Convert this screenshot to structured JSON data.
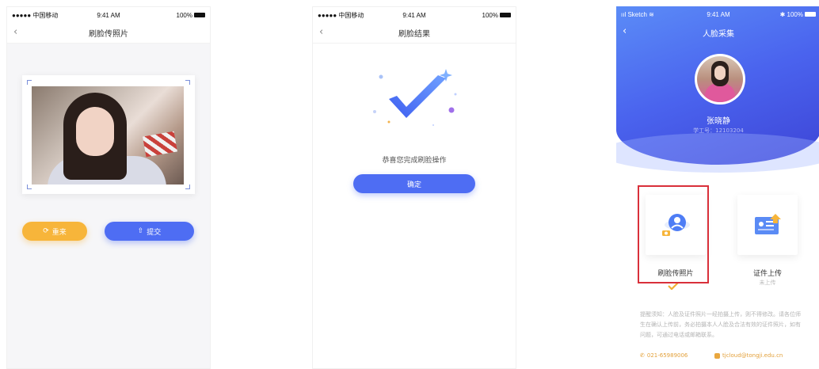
{
  "phone1": {
    "status": {
      "carrier": "●●●●● 中国移动",
      "time": "9:41 AM",
      "battery": "100%"
    },
    "title": "刷脸传照片",
    "retake_label": "重来",
    "submit_label": "提交"
  },
  "phone2": {
    "status": {
      "carrier": "●●●●● 中国移动",
      "time": "9:41 AM",
      "battery": "100%"
    },
    "title": "刷脸结果",
    "message": "恭喜您完成刷脸操作",
    "confirm_label": "确定"
  },
  "phone3": {
    "status": {
      "carrier": "Sketch",
      "time": "9:41 AM",
      "battery": "100%"
    },
    "title": "人脸采集",
    "student_name": "张晓静",
    "student_id": "学工号：12103204",
    "tile_face_label": "刷脸传照片",
    "tile_cert_label": "证件上传",
    "tile_cert_status": "未上传",
    "notice": "提醒须知：人脸及证件照片一经拍摄上传，则不得修改。请各位师生在确认上传前，务必拍摄本人人脸及合法有效的证件照片，如有问题，可通过电话或邮箱联系。",
    "phone": "021-65989006",
    "email": "tjcloud@tongji.edu.cn"
  },
  "colors": {
    "primary": "#4e6df3",
    "accent_orange": "#f7b53a",
    "highlight_red": "#d9303a"
  }
}
